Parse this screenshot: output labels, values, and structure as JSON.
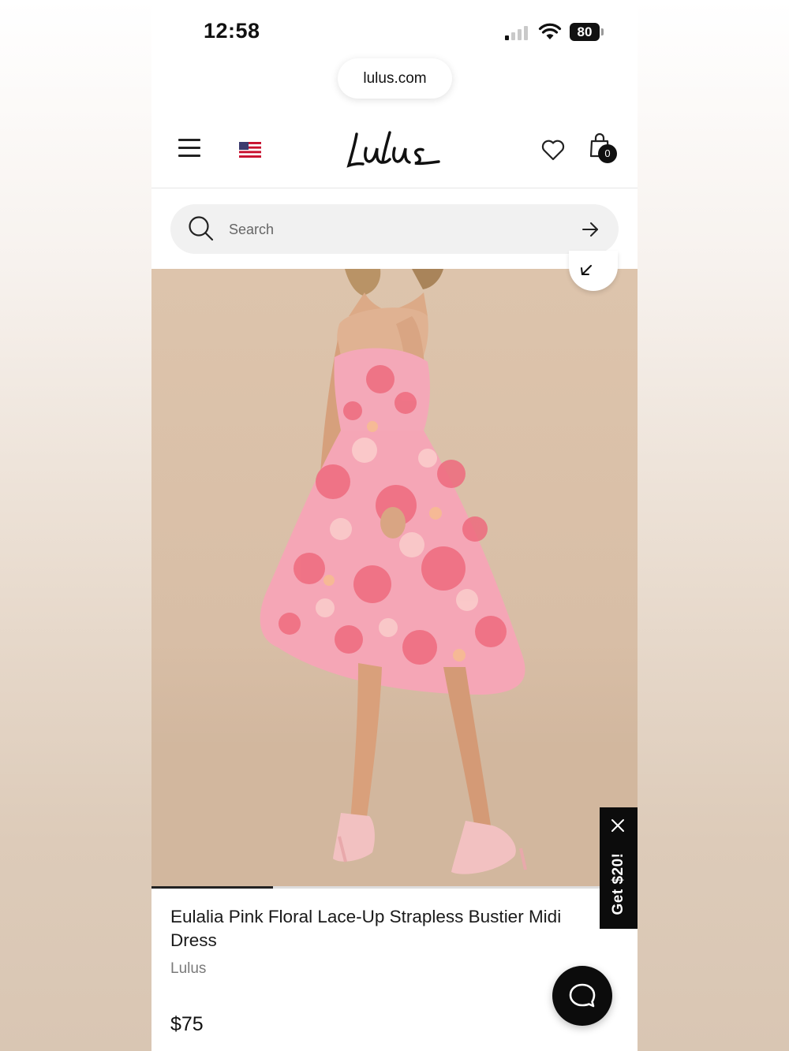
{
  "status_bar": {
    "time": "12:58",
    "battery": "80",
    "signal_bars": 1,
    "wifi": "wifi-icon"
  },
  "browser": {
    "url": "lulus.com"
  },
  "header": {
    "brand_logo": "Lulus",
    "menu_icon": "hamburger-menu-icon",
    "flag_icon": "us-flag-icon",
    "wishlist_icon": "heart-icon",
    "bag_icon": "shopping-bag-icon",
    "bag_count": "0"
  },
  "search": {
    "placeholder": "Search",
    "value": ""
  },
  "product": {
    "image_alt": "Model wearing pink floral strapless bustier midi dress with pink heels",
    "expand_icon": "collapse-arrow-icon",
    "image_index": 1,
    "image_count": 4,
    "title": "Eulalia Pink Floral Lace-Up Strapless Bustier Midi Dress",
    "brand": "Lulus",
    "price": "$75"
  },
  "promo": {
    "label": "Get $20!",
    "close_icon": "close-icon"
  },
  "chat": {
    "icon": "chat-bubble-icon"
  },
  "colors": {
    "text": "#111111",
    "muted": "#7a7a7a",
    "search_bg": "#f1f1f1",
    "dark": "#0c0c0c",
    "dress_pink": "#f3a9b8"
  }
}
